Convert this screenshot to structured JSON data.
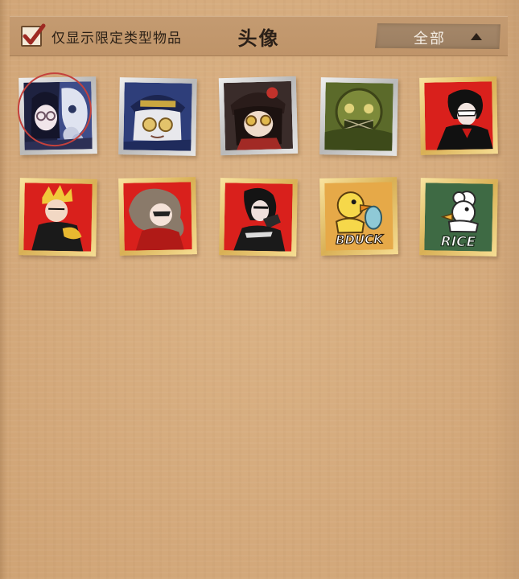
{
  "header": {
    "filter_label": "仅显示限定类型物品",
    "filter_checked": true,
    "title": "头像",
    "dropdown_value": "全部"
  },
  "avatars": [
    {
      "icon": "masked-pair-avatar-icon",
      "frame": "silver",
      "selected": true
    },
    {
      "icon": "goggles-hat-avatar-icon",
      "frame": "silver",
      "selected": false
    },
    {
      "icon": "dark-hair-goggles-avatar-icon",
      "frame": "silver",
      "selected": false
    },
    {
      "icon": "green-machine-avatar-icon",
      "frame": "silver",
      "selected": false
    },
    {
      "icon": "joker-avatar-icon",
      "frame": "gold",
      "selected": false
    },
    {
      "icon": "skull-avatar-icon",
      "frame": "gold",
      "selected": false
    },
    {
      "icon": "panther-avatar-icon",
      "frame": "gold",
      "selected": false
    },
    {
      "icon": "queen-avatar-icon",
      "frame": "gold",
      "selected": false
    },
    {
      "icon": "bduck-avatar-icon",
      "frame": "gold",
      "selected": false,
      "text": "BDUCK"
    },
    {
      "icon": "rice-avatar-icon",
      "frame": "gold",
      "selected": false,
      "text": "RICE"
    }
  ],
  "colors": {
    "background": "#d7ad80",
    "header": "#c49b71",
    "persona_red": "#d9201c",
    "selection_ring": "#c4413c"
  }
}
